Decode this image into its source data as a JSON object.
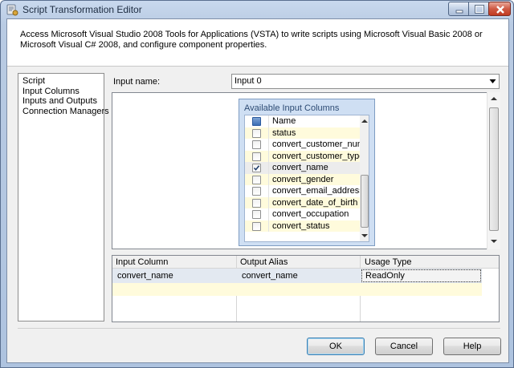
{
  "window": {
    "title": "Script Transformation Editor"
  },
  "description": "Access Microsoft Visual Studio 2008 Tools for Applications (VSTA) to write scripts using Microsoft Visual Basic 2008 or Microsoft Visual C# 2008, and configure component properties.",
  "nav": {
    "items": [
      "Script",
      "Input Columns",
      "Inputs and Outputs",
      "Connection Managers"
    ],
    "selected": "Input Columns"
  },
  "input": {
    "label": "Input name:",
    "value": "Input 0"
  },
  "available": {
    "title": "Available Input Columns",
    "header": "Name",
    "columns": [
      {
        "name": "status",
        "checked": false
      },
      {
        "name": "convert_customer_number",
        "checked": false
      },
      {
        "name": "convert_customer_type",
        "checked": false
      },
      {
        "name": "convert_name",
        "checked": true
      },
      {
        "name": "convert_gender",
        "checked": false
      },
      {
        "name": "convert_email_address",
        "checked": false
      },
      {
        "name": "convert_date_of_birth",
        "checked": false
      },
      {
        "name": "convert_occupation",
        "checked": false
      },
      {
        "name": "convert_status",
        "checked": false
      }
    ]
  },
  "grid": {
    "headers": [
      "Input Column",
      "Output Alias",
      "Usage Type"
    ],
    "rows": [
      {
        "input_column": "convert_name",
        "output_alias": "convert_name",
        "usage_type": "ReadOnly"
      }
    ]
  },
  "buttons": {
    "ok": "OK",
    "cancel": "Cancel",
    "help": "Help"
  }
}
